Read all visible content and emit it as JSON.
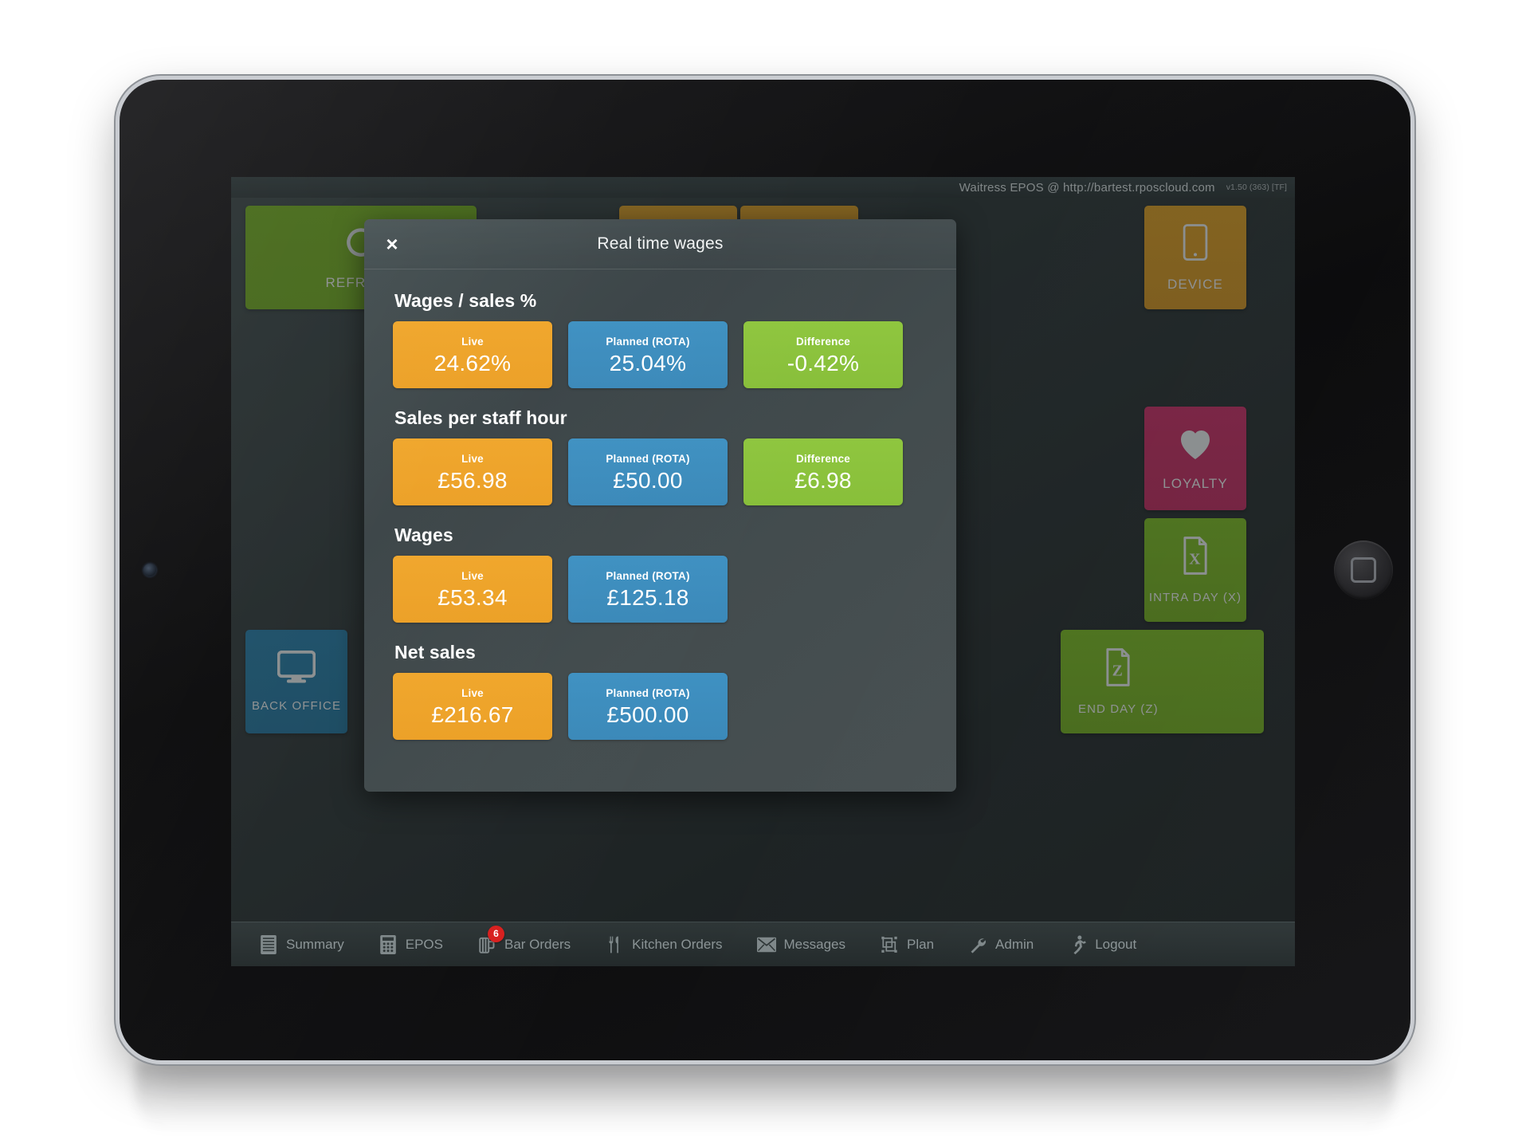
{
  "app": {
    "statusbar_text": "Waitress EPOS @ http://bartest.rposcloud.com",
    "version": "v1.50 (363) [TF]"
  },
  "tiles": [
    {
      "label": "REFRESH",
      "icon": "refresh-icon",
      "color": "#72a824"
    },
    {
      "label": "",
      "icon": "hidden-tile-icon",
      "color": "#d39a2c"
    },
    {
      "label": "",
      "icon": "hidden-tile-icon",
      "color": "#d39a2c"
    },
    {
      "label": "DEVICE",
      "icon": "tablet-icon",
      "color": "#d39a2c"
    },
    {
      "label": "LOYALTY",
      "icon": "heart-icon",
      "color": "#c43469"
    },
    {
      "label": "INTRA DAY (X)",
      "icon": "document-x-icon",
      "color": "#7cb62b"
    },
    {
      "label": "END DAY (Z)",
      "icon": "document-z-icon",
      "color": "#7cb62b"
    },
    {
      "label": "BACK OFFICE",
      "icon": "monitor-icon",
      "color": "#2a7ba4"
    }
  ],
  "nav": [
    {
      "label": "Summary",
      "icon": "list-icon",
      "badge": ""
    },
    {
      "label": "EPOS",
      "icon": "keypad-icon",
      "badge": ""
    },
    {
      "label": "Bar Orders",
      "icon": "beer-mug-icon",
      "badge": "6"
    },
    {
      "label": "Kitchen Orders",
      "icon": "cutlery-icon",
      "badge": ""
    },
    {
      "label": "Messages",
      "icon": "envelope-icon",
      "badge": ""
    },
    {
      "label": "Plan",
      "icon": "shapes-icon",
      "badge": ""
    },
    {
      "label": "Admin",
      "icon": "wrench-icon",
      "badge": ""
    },
    {
      "label": "Logout",
      "icon": "running-person-icon",
      "badge": ""
    }
  ],
  "modal": {
    "title": "Real time wages",
    "close_label": "×",
    "groups": [
      {
        "title": "Wages / sales %",
        "cards": [
          {
            "label": "Live",
            "value": "24.62%",
            "kind": "live"
          },
          {
            "label": "Planned (ROTA)",
            "value": "25.04%",
            "kind": "planned"
          },
          {
            "label": "Difference",
            "value": "-0.42%",
            "kind": "difference"
          }
        ]
      },
      {
        "title": "Sales per staff hour",
        "cards": [
          {
            "label": "Live",
            "value": "£56.98",
            "kind": "live"
          },
          {
            "label": "Planned (ROTA)",
            "value": "£50.00",
            "kind": "planned"
          },
          {
            "label": "Difference",
            "value": "£6.98",
            "kind": "difference"
          }
        ]
      },
      {
        "title": "Wages",
        "cards": [
          {
            "label": "Live",
            "value": "£53.34",
            "kind": "live"
          },
          {
            "label": "Planned (ROTA)",
            "value": "£125.18",
            "kind": "planned"
          }
        ]
      },
      {
        "title": "Net sales",
        "cards": [
          {
            "label": "Live",
            "value": "£216.67",
            "kind": "live"
          },
          {
            "label": "Planned (ROTA)",
            "value": "£500.00",
            "kind": "planned"
          }
        ]
      }
    ]
  },
  "colors": {
    "live": "#efa328",
    "planned": "#3c8cbe",
    "difference": "#8cc63e",
    "badge": "#d8201f",
    "modal_bg": "#414a4c",
    "app_bg": "#343c3e"
  }
}
